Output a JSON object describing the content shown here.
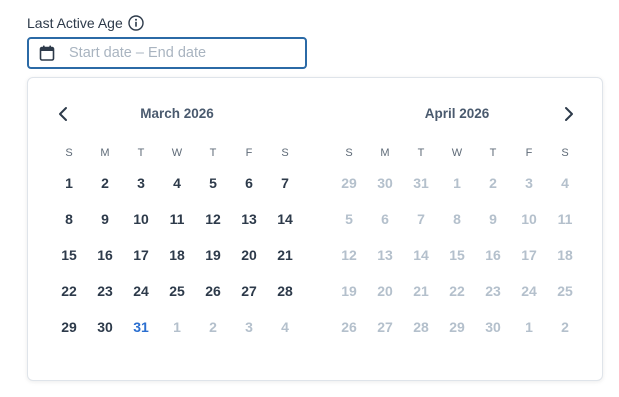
{
  "field": {
    "label": "Last Active Age",
    "placeholder": "Start date – End date"
  },
  "colors": {
    "accent": "#2b6aa6",
    "today": "#2b6fd0",
    "text": "#2d3a4a",
    "muted": "#b4c0cc"
  },
  "icons": {
    "info": "info-icon",
    "calendar": "calendar-icon",
    "prev": "chevron-left-icon",
    "next": "chevron-right-icon"
  },
  "calendar": {
    "weekdays": [
      "S",
      "M",
      "T",
      "W",
      "T",
      "F",
      "S"
    ],
    "months": [
      {
        "title": "March  2026",
        "days": [
          [
            "1",
            "cur"
          ],
          [
            "2",
            "cur"
          ],
          [
            "3",
            "cur"
          ],
          [
            "4",
            "cur"
          ],
          [
            "5",
            "cur"
          ],
          [
            "6",
            "cur"
          ],
          [
            "7",
            "cur"
          ],
          [
            "8",
            "cur"
          ],
          [
            "9",
            "cur"
          ],
          [
            "10",
            "cur"
          ],
          [
            "11",
            "cur"
          ],
          [
            "12",
            "cur"
          ],
          [
            "13",
            "cur"
          ],
          [
            "14",
            "cur"
          ],
          [
            "15",
            "cur"
          ],
          [
            "16",
            "cur"
          ],
          [
            "17",
            "cur"
          ],
          [
            "18",
            "cur"
          ],
          [
            "19",
            "cur"
          ],
          [
            "20",
            "cur"
          ],
          [
            "21",
            "cur"
          ],
          [
            "22",
            "cur"
          ],
          [
            "23",
            "cur"
          ],
          [
            "24",
            "cur"
          ],
          [
            "25",
            "cur"
          ],
          [
            "26",
            "cur"
          ],
          [
            "27",
            "cur"
          ],
          [
            "28",
            "cur"
          ],
          [
            "29",
            "cur"
          ],
          [
            "30",
            "cur"
          ],
          [
            "31",
            "today"
          ],
          [
            "1",
            "out"
          ],
          [
            "2",
            "out"
          ],
          [
            "3",
            "out"
          ],
          [
            "4",
            "out"
          ]
        ]
      },
      {
        "title": "April  2026",
        "days": [
          [
            "29",
            "prev"
          ],
          [
            "30",
            "prev"
          ],
          [
            "31",
            "prev"
          ],
          [
            "1",
            "na"
          ],
          [
            "2",
            "na"
          ],
          [
            "3",
            "na"
          ],
          [
            "4",
            "na"
          ],
          [
            "5",
            "na"
          ],
          [
            "6",
            "na"
          ],
          [
            "7",
            "na"
          ],
          [
            "8",
            "na"
          ],
          [
            "9",
            "na"
          ],
          [
            "10",
            "na"
          ],
          [
            "11",
            "na"
          ],
          [
            "12",
            "na"
          ],
          [
            "13",
            "na"
          ],
          [
            "14",
            "na"
          ],
          [
            "15",
            "na"
          ],
          [
            "16",
            "na"
          ],
          [
            "17",
            "na"
          ],
          [
            "18",
            "na"
          ],
          [
            "19",
            "na"
          ],
          [
            "20",
            "na"
          ],
          [
            "21",
            "na"
          ],
          [
            "22",
            "na"
          ],
          [
            "23",
            "na"
          ],
          [
            "24",
            "na"
          ],
          [
            "25",
            "na"
          ],
          [
            "26",
            "na"
          ],
          [
            "27",
            "na"
          ],
          [
            "28",
            "na"
          ],
          [
            "29",
            "na"
          ],
          [
            "30",
            "na"
          ],
          [
            "1",
            "na"
          ],
          [
            "2",
            "na"
          ]
        ]
      }
    ]
  }
}
